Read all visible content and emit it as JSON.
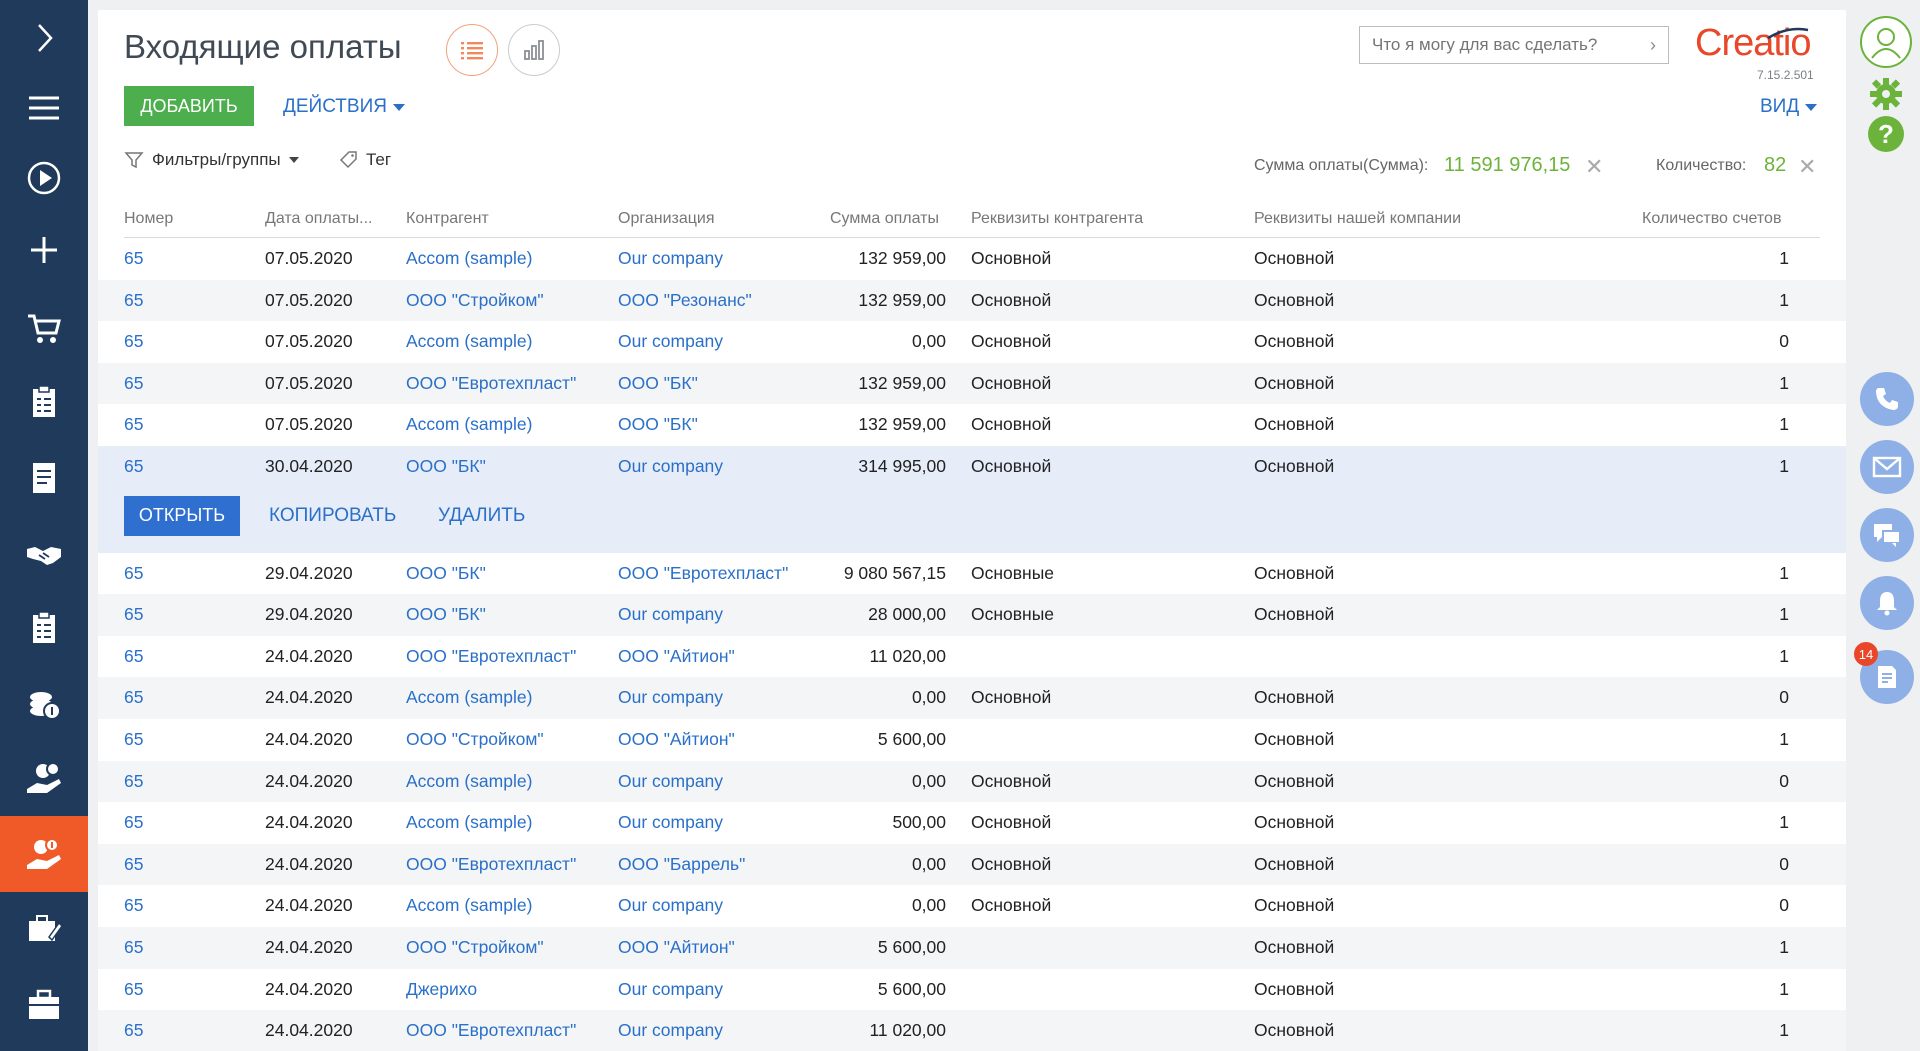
{
  "header": {
    "title": "Входящие оплаты",
    "search_placeholder": "Что я могу для вас сделать?",
    "logo": "Creatio",
    "version": "7.15.2.501"
  },
  "toolbar": {
    "add_label": "ДОБАВИТЬ",
    "actions_label": "ДЕЙСТВИЯ",
    "view_label": "ВИД"
  },
  "filters": {
    "filters_label": "Фильтры/группы",
    "tag_label": "Тег"
  },
  "summary": {
    "sum_label": "Сумма оплаты(Сумма):",
    "sum_value": "11 591 976,15",
    "count_label": "Количество:",
    "count_value": "82"
  },
  "grid": {
    "columns": [
      "Номер",
      "Дата оплаты...",
      "Контрагент",
      "Организация",
      "Сумма оплаты",
      "Реквизиты контрагента",
      "Реквизиты нашей компании",
      "Количество счетов"
    ],
    "rows_top": [
      {
        "num": "65",
        "date": "07.05.2020",
        "contractor": "Accom (sample)",
        "org": "Our company",
        "sum": "132 959,00",
        "contractor_req": "Основной",
        "our_req": "Основной",
        "invoices": "1"
      },
      {
        "num": "65",
        "date": "07.05.2020",
        "contractor": "ООО \"Стройком\"",
        "org": "ООО \"Резонанс\"",
        "sum": "132 959,00",
        "contractor_req": "Основной",
        "our_req": "Основной",
        "invoices": "1"
      },
      {
        "num": "65",
        "date": "07.05.2020",
        "contractor": "Accom (sample)",
        "org": "Our company",
        "sum": "0,00",
        "contractor_req": "Основной",
        "our_req": "Основной",
        "invoices": "0"
      },
      {
        "num": "65",
        "date": "07.05.2020",
        "contractor": "ООО \"Евротехпласт\"",
        "org": "ООО \"БК\"",
        "sum": "132 959,00",
        "contractor_req": "Основной",
        "our_req": "Основной",
        "invoices": "1"
      },
      {
        "num": "65",
        "date": "07.05.2020",
        "contractor": "Accom (sample)",
        "org": "ООО \"БК\"",
        "sum": "132 959,00",
        "contractor_req": "Основной",
        "our_req": "Основной",
        "invoices": "1"
      },
      {
        "num": "65",
        "date": "30.04.2020",
        "contractor": "ООО \"БК\"",
        "org": "Our company",
        "sum": "314 995,00",
        "contractor_req": "Основной",
        "our_req": "Основной",
        "invoices": "1"
      }
    ],
    "row_actions": {
      "open": "ОТКРЫТЬ",
      "copy": "КОПИРОВАТЬ",
      "delete": "УДАЛИТЬ"
    },
    "rows_bottom": [
      {
        "num": "65",
        "date": "29.04.2020",
        "contractor": "ООО \"БК\"",
        "org": "ООО \"Евротехпласт\"",
        "sum": "9 080 567,15",
        "contractor_req": "Основные",
        "our_req": "Основной",
        "invoices": "1"
      },
      {
        "num": "65",
        "date": "29.04.2020",
        "contractor": "ООО \"БК\"",
        "org": "Our company",
        "sum": "28 000,00",
        "contractor_req": "Основные",
        "our_req": "Основной",
        "invoices": "1"
      },
      {
        "num": "65",
        "date": "24.04.2020",
        "contractor": "ООО \"Евротехпласт\"",
        "org": "ООО \"Айтион\"",
        "sum": "11 020,00",
        "contractor_req": "",
        "our_req": "",
        "invoices": "1"
      },
      {
        "num": "65",
        "date": "24.04.2020",
        "contractor": "Accom (sample)",
        "org": "Our company",
        "sum": "0,00",
        "contractor_req": "Основной",
        "our_req": "Основной",
        "invoices": "0"
      },
      {
        "num": "65",
        "date": "24.04.2020",
        "contractor": "ООО \"Стройком\"",
        "org": "ООО \"Айтион\"",
        "sum": "5 600,00",
        "contractor_req": "",
        "our_req": "Основной",
        "invoices": "1"
      },
      {
        "num": "65",
        "date": "24.04.2020",
        "contractor": "Accom (sample)",
        "org": "Our company",
        "sum": "0,00",
        "contractor_req": "Основной",
        "our_req": "Основной",
        "invoices": "0"
      },
      {
        "num": "65",
        "date": "24.04.2020",
        "contractor": "Accom (sample)",
        "org": "Our company",
        "sum": "500,00",
        "contractor_req": "Основной",
        "our_req": "Основной",
        "invoices": "1"
      },
      {
        "num": "65",
        "date": "24.04.2020",
        "contractor": "ООО \"Евротехпласт\"",
        "org": "ООО \"Баррель\"",
        "sum": "0,00",
        "contractor_req": "Основной",
        "our_req": "Основной",
        "invoices": "0"
      },
      {
        "num": "65",
        "date": "24.04.2020",
        "contractor": "Accom (sample)",
        "org": "Our company",
        "sum": "0,00",
        "contractor_req": "Основной",
        "our_req": "Основной",
        "invoices": "0"
      },
      {
        "num": "65",
        "date": "24.04.2020",
        "contractor": "ООО \"Стройком\"",
        "org": "ООО \"Айтион\"",
        "sum": "5 600,00",
        "contractor_req": "",
        "our_req": "Основной",
        "invoices": "1"
      },
      {
        "num": "65",
        "date": "24.04.2020",
        "contractor": "Джерихо",
        "org": "Our company",
        "sum": "5 600,00",
        "contractor_req": "",
        "our_req": "Основной",
        "invoices": "1"
      },
      {
        "num": "65",
        "date": "24.04.2020",
        "contractor": "ООО \"Евротехпласт\"",
        "org": "Our company",
        "sum": "11 020,00",
        "contractor_req": "",
        "our_req": "Основной",
        "invoices": "1"
      }
    ]
  },
  "rightpanel": {
    "notification_count": "14"
  },
  "colors": {
    "nav_bg": "#1f3a5a",
    "nav_active": "#f05a28",
    "link": "#2a70c8",
    "add_green": "#4cae4c",
    "summary_green": "#6bb33a",
    "selected_row": "#e6edf8"
  },
  "icons": {
    "leftnav": [
      "chevron-right-icon",
      "menu-icon",
      "play-icon",
      "plus-icon",
      "cart-icon",
      "checklist-icon",
      "document-icon",
      "handshake-icon",
      "checklist-icon",
      "coins-icon",
      "hand-gear-icon",
      "hand-coin-icon",
      "briefcase-pen-icon",
      "briefcase-icon"
    ],
    "rightpanel": [
      "avatar-icon",
      "gear-icon",
      "help-icon",
      "phone-icon",
      "mail-icon",
      "chat-icon",
      "bell-icon",
      "feed-icon"
    ]
  }
}
